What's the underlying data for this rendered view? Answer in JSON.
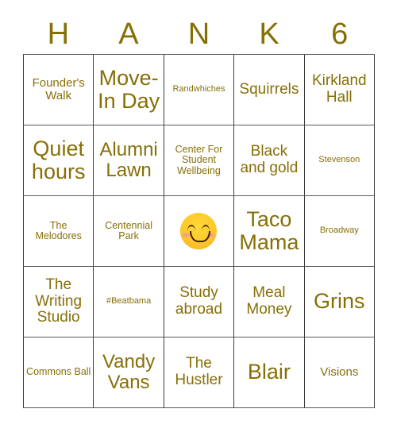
{
  "card": {
    "header_letters": [
      "H",
      "A",
      "N",
      "K",
      "6"
    ],
    "text_color": "#876F06",
    "grid_line_color": "#3b3b3b",
    "rows": [
      [
        {
          "label": "Founder's Walk",
          "size": "sm"
        },
        {
          "label": "Move-In Day",
          "size": "xl"
        },
        {
          "label": "Randwhiches",
          "size": "xxs"
        },
        {
          "label": "Squirrels",
          "size": "md"
        },
        {
          "label": "Kirkland Hall",
          "size": "md"
        }
      ],
      [
        {
          "label": "Quiet hours",
          "size": "xl"
        },
        {
          "label": "Alumni Lawn",
          "size": "lg"
        },
        {
          "label": "Center For Student Wellbeing",
          "size": "xs"
        },
        {
          "label": "Black and gold",
          "size": "md"
        },
        {
          "label": "Stevenson",
          "size": "xxs"
        }
      ],
      [
        {
          "label": "The Melodores",
          "size": "xs"
        },
        {
          "label": "Centennial Park",
          "size": "xs"
        },
        {
          "label": "",
          "size": "md",
          "icon": "smiling-face-emoji",
          "free_space": true
        },
        {
          "label": "Taco Mama",
          "size": "xl"
        },
        {
          "label": "Broadway",
          "size": "xxs"
        }
      ],
      [
        {
          "label": "The Writing Studio",
          "size": "md"
        },
        {
          "label": "#Beatbama",
          "size": "xxs"
        },
        {
          "label": "Study abroad",
          "size": "md"
        },
        {
          "label": "Meal Money",
          "size": "md"
        },
        {
          "label": "Grins",
          "size": "xl"
        }
      ],
      [
        {
          "label": "Commons Ball",
          "size": "xs"
        },
        {
          "label": "Vandy Vans",
          "size": "lg"
        },
        {
          "label": "The Hustler",
          "size": "md"
        },
        {
          "label": "Blair",
          "size": "xl"
        },
        {
          "label": "Visions",
          "size": "sm"
        }
      ]
    ]
  }
}
